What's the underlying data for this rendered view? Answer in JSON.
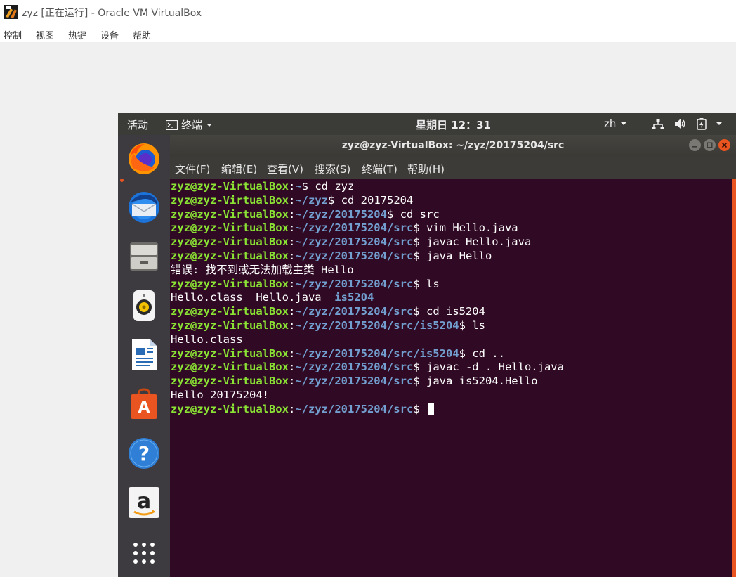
{
  "host": {
    "title": "zyz [正在运行] - Oracle VM VirtualBox",
    "menu": [
      "控制",
      "视图",
      "热键",
      "设备",
      "帮助"
    ]
  },
  "topbar": {
    "activities": "活动",
    "app_menu": "终端",
    "clock": "星期日 12：31",
    "input_method": "zh"
  },
  "dock": {
    "apps": [
      "firefox",
      "thunderbird",
      "files",
      "rhythmbox",
      "libreoffice-writer",
      "ubuntu-software",
      "help",
      "amazon",
      "show-applications"
    ]
  },
  "terminal": {
    "title": "zyz@zyz-VirtualBox: ~/zyz/20175204/src",
    "menu": [
      "文件(F)",
      "编辑(E)",
      "查看(V)",
      "搜索(S)",
      "终端(T)",
      "帮助(H)"
    ],
    "prompt_user": "zyz@zyz-VirtualBox",
    "lines": [
      {
        "type": "cmd",
        "path": "~",
        "command": " cd zyz"
      },
      {
        "type": "cmd",
        "path": "~/zyz",
        "command": " cd 20175204"
      },
      {
        "type": "cmd",
        "path": "~/zyz/20175204",
        "command": " cd src"
      },
      {
        "type": "cmd",
        "path": "~/zyz/20175204/src",
        "command": " vim Hello.java"
      },
      {
        "type": "cmd",
        "path": "~/zyz/20175204/src",
        "command": " javac Hello.java"
      },
      {
        "type": "cmd",
        "path": "~/zyz/20175204/src",
        "command": " java Hello"
      },
      {
        "type": "out",
        "text": "错误: 找不到或无法加载主类 Hello"
      },
      {
        "type": "cmd",
        "path": "~/zyz/20175204/src",
        "command": " ls"
      },
      {
        "type": "ls",
        "files": "Hello.class  Hello.java  ",
        "dir": "is5204"
      },
      {
        "type": "cmd",
        "path": "~/zyz/20175204/src",
        "command": " cd is5204"
      },
      {
        "type": "cmd",
        "path": "~/zyz/20175204/src/is5204",
        "command": " ls"
      },
      {
        "type": "out",
        "text": "Hello.class"
      },
      {
        "type": "cmd",
        "path": "~/zyz/20175204/src/is5204",
        "command": " cd .."
      },
      {
        "type": "cmd",
        "path": "~/zyz/20175204/src",
        "command": " javac -d . Hello.java"
      },
      {
        "type": "cmd",
        "path": "~/zyz/20175204/src",
        "command": " java is5204.Hello"
      },
      {
        "type": "out",
        "text": "Hello 20175204!"
      },
      {
        "type": "cursor",
        "path": "~/zyz/20175204/src",
        "command": " "
      }
    ]
  }
}
